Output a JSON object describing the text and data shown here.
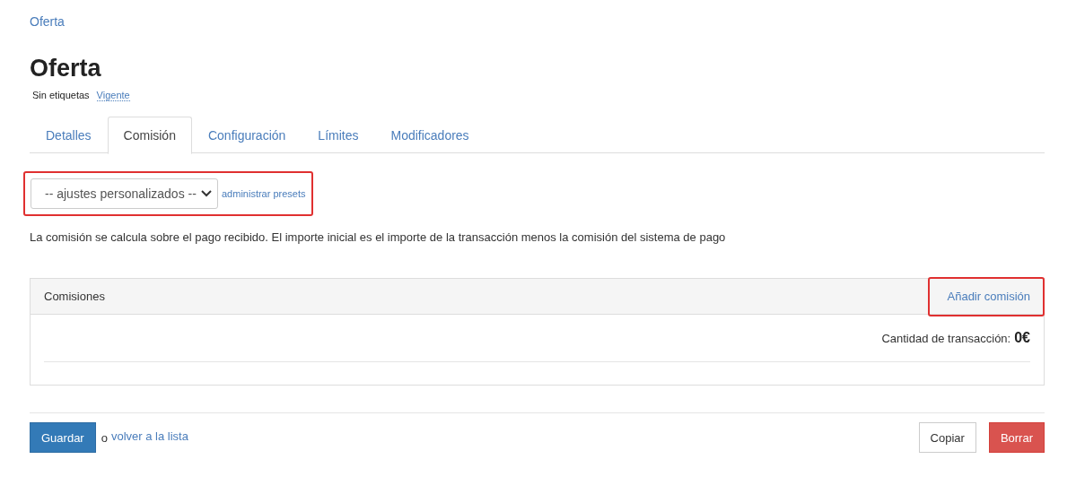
{
  "breadcrumb": "Oferta",
  "title": "Oferta",
  "meta": {
    "tags": "Sin etiquetas",
    "status": "Vigente"
  },
  "tabs": [
    {
      "label": "Detalles",
      "selected": false
    },
    {
      "label": "Comisión",
      "selected": true
    },
    {
      "label": "Configuración",
      "selected": false
    },
    {
      "label": "Límites",
      "selected": false
    },
    {
      "label": "Modificadores",
      "selected": false
    }
  ],
  "preset": {
    "value": "-- ajustes personalizados --",
    "link": "administrar presets",
    "highlighted": true
  },
  "description": "La comisión se calcula sobre el pago recibido. El importe inicial es el importe de la transacción menos la comisión del sistema de pago",
  "panel": {
    "title": "Comisiones",
    "add_button": "Añadir comisión",
    "add_highlighted": true,
    "total_label": "Cantidad de transacción:",
    "total_value": "0€"
  },
  "footer": {
    "save": "Guardar",
    "or": "o",
    "back_link": "volver a la lista",
    "copy": "Copiar",
    "delete": "Borrar"
  }
}
